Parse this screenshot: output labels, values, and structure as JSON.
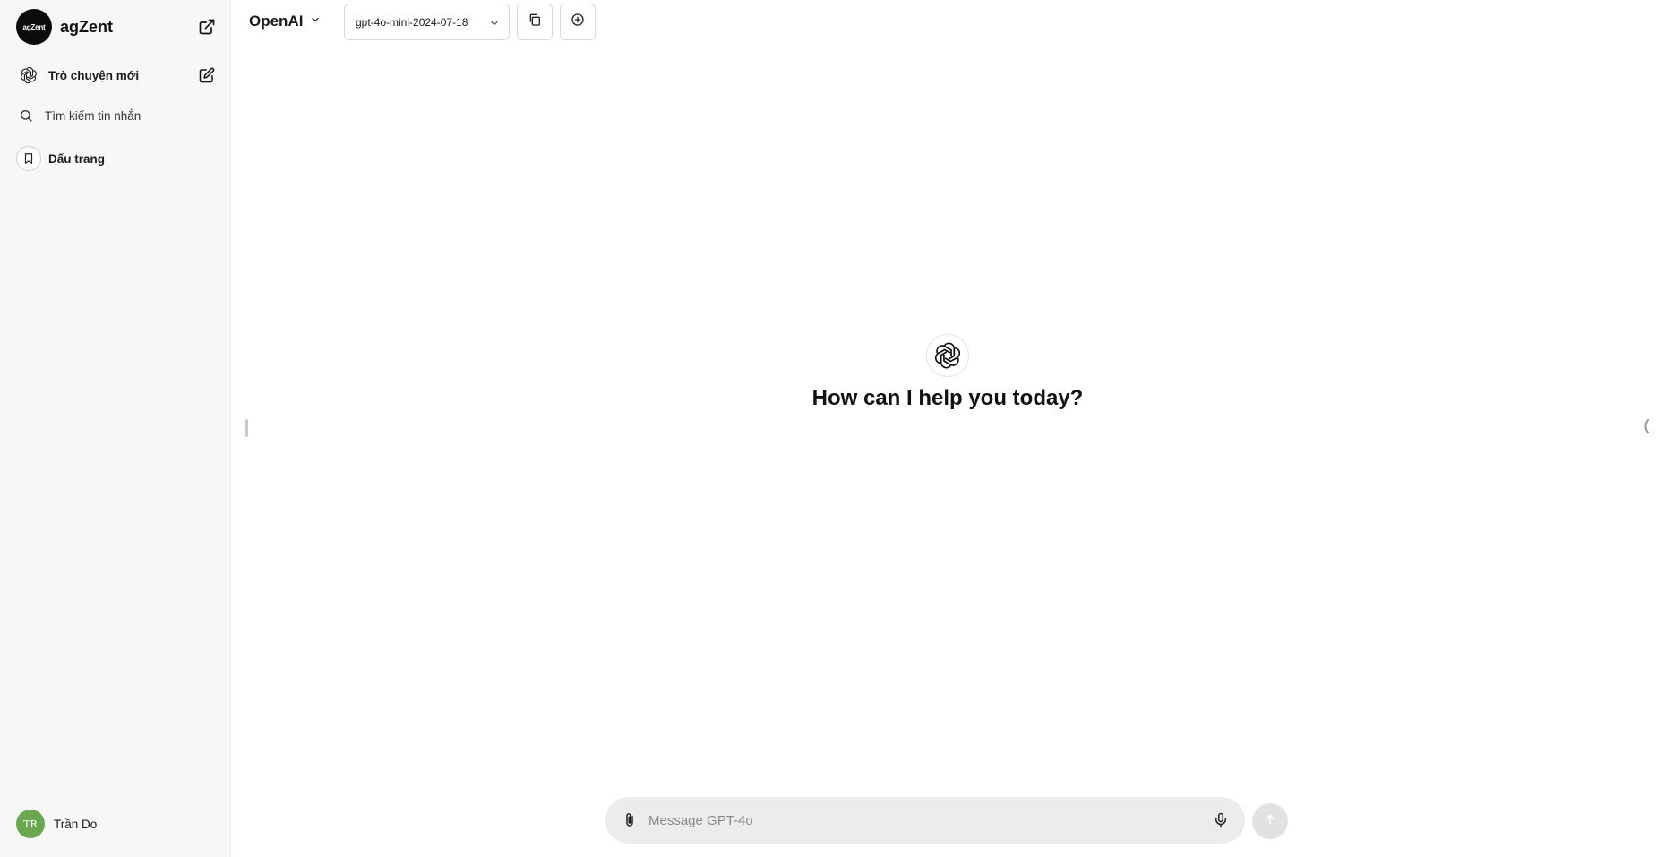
{
  "sidebar": {
    "brand": {
      "logo_text": "agZent",
      "name": "agZent",
      "external_icon": "external-link-icon"
    },
    "new_chat": {
      "label": "Trò chuyện mới",
      "icon": "openai-icon",
      "action_icon": "edit-icon"
    },
    "search": {
      "label": "Tìm kiếm tin nhắn",
      "icon": "search-icon"
    },
    "bookmarks": {
      "label": "Dấu trang",
      "icon": "bookmark-icon"
    },
    "user": {
      "initials": "TR",
      "name": "Trần Do"
    }
  },
  "topbar": {
    "provider": {
      "label": "OpenAI",
      "icon": "chevron-down-icon"
    },
    "model": {
      "label": "gpt-4o-mini-2024-07-18",
      "icon": "chevron-down-icon"
    },
    "buttons": [
      {
        "icon": "copy-icon"
      },
      {
        "icon": "plus-circle-icon"
      }
    ]
  },
  "main": {
    "icon": "openai-icon",
    "greeting": "How can I help you today?"
  },
  "composer": {
    "placeholder": "Message GPT-4o",
    "value": "",
    "attach_icon": "paperclip-icon",
    "mic_icon": "microphone-icon",
    "send_icon": "arrow-up-icon"
  },
  "colors": {
    "sidebar_bg": "#f7f7f7",
    "composer_bg": "#ececec",
    "avatar_bg": "#6aa84f",
    "brand_logo_bg": "#0b0b0b"
  }
}
